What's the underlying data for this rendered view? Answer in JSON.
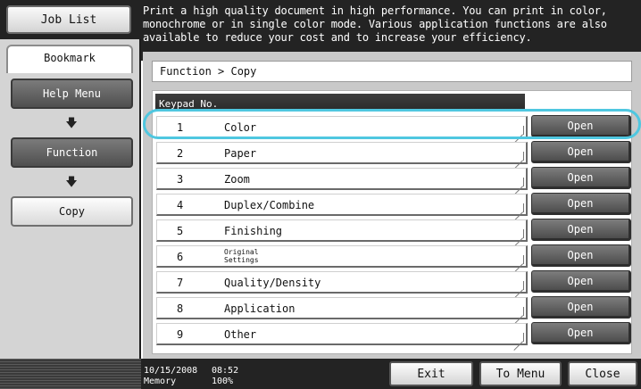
{
  "header": {
    "job_list_label": "Job List",
    "message": "Print a high quality document in high performance. You can print in color, monochrome or in single color mode. Various application functions are also available to reduce your cost and to increase your efficiency."
  },
  "sidebar": {
    "bookmark_tab": "Bookmark",
    "items": [
      {
        "label": "Help Menu"
      },
      {
        "label": "Function"
      },
      {
        "label": "Copy"
      }
    ],
    "arrow_glyph": "🡇"
  },
  "main": {
    "breadcrumb": "Function > Copy",
    "keypad_header": "Keypad No.",
    "open_label": "Open",
    "rows": [
      {
        "num": "1",
        "label": "Color"
      },
      {
        "num": "2",
        "label": "Paper"
      },
      {
        "num": "3",
        "label": "Zoom"
      },
      {
        "num": "4",
        "label": "Duplex/Combine"
      },
      {
        "num": "5",
        "label": "Finishing"
      },
      {
        "num": "6",
        "label": "Original Settings"
      },
      {
        "num": "7",
        "label": "Quality/Density"
      },
      {
        "num": "8",
        "label": "Application"
      },
      {
        "num": "9",
        "label": "Other"
      }
    ]
  },
  "footer": {
    "date": "10/15/2008",
    "time": "08:52",
    "memory_label": "Memory",
    "memory_value": "100%",
    "exit_label": "Exit",
    "to_menu_label": "To Menu",
    "close_label": "Close"
  },
  "colors": {
    "highlight": "#4fc7e0",
    "dark_button": "#5f5f5f"
  }
}
